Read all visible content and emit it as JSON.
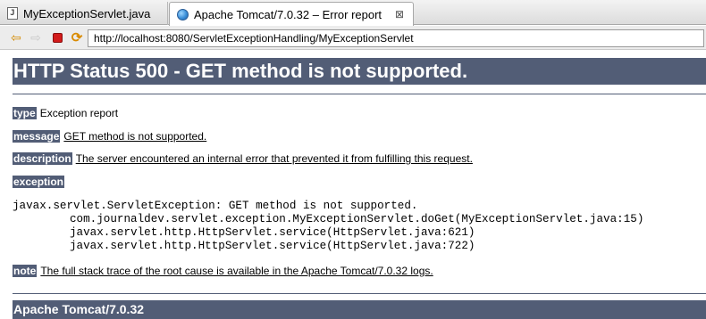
{
  "tabs": [
    {
      "label": "MyExceptionServlet.java",
      "icon": "java-file-icon"
    },
    {
      "label": "Apache Tomcat/7.0.32 – Error report",
      "icon": "globe-icon",
      "close": "⊠"
    }
  ],
  "toolbar": {
    "url": "http://localhost:8080/ServletExceptionHandling/MyExceptionServlet"
  },
  "page": {
    "heading": "HTTP Status 500 - GET method is not supported.",
    "type_label": "type",
    "type_value": "Exception report",
    "message_label": "message",
    "message_value": "GET method is not supported.",
    "description_label": "description",
    "description_value": "The server encountered an internal error that prevented it from fulfilling this request.",
    "exception_label": "exception",
    "stack": [
      "javax.servlet.ServletException: GET method is not supported.",
      "com.journaldev.servlet.exception.MyExceptionServlet.doGet(MyExceptionServlet.java:15)",
      "javax.servlet.http.HttpServlet.service(HttpServlet.java:621)",
      "javax.servlet.http.HttpServlet.service(HttpServlet.java:722)"
    ],
    "note_label": "note",
    "note_value": "The full stack trace of the root cause is available in the Apache Tomcat/7.0.32 logs.",
    "footer": "Apache Tomcat/7.0.32"
  },
  "colors": {
    "header_bg": "#525d76",
    "header_text": "#ffffff"
  }
}
